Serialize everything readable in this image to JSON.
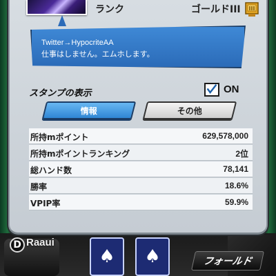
{
  "header": {
    "rank_label": "ランク",
    "rank_value": "ゴールドIII"
  },
  "bubble": {
    "line1": "Twitter→HypocriteAA",
    "line2": "仕事はしません。エムホします。"
  },
  "stamp": {
    "label": "スタンプの表示",
    "state": "ON"
  },
  "tabs": [
    {
      "label": "情報"
    },
    {
      "label": "その他"
    }
  ],
  "stats": [
    {
      "label": "所持mポイント",
      "value": "629,578,000"
    },
    {
      "label": "所持mポイントランキング",
      "value": "2位"
    },
    {
      "label": "総ハンド数",
      "value": "78,141"
    },
    {
      "label": "勝率",
      "value": "18.6%"
    },
    {
      "label": "VPIP率",
      "value": "59.9%"
    }
  ],
  "background": {
    "dealer_badge": "D",
    "player_name": "Raaui",
    "fold_button": "フォールド",
    "card_suit": "♠"
  },
  "colors": {
    "accent_blue": "#2f86d4",
    "panel": "#d7dde2",
    "rank_gold": "#e2a526"
  }
}
